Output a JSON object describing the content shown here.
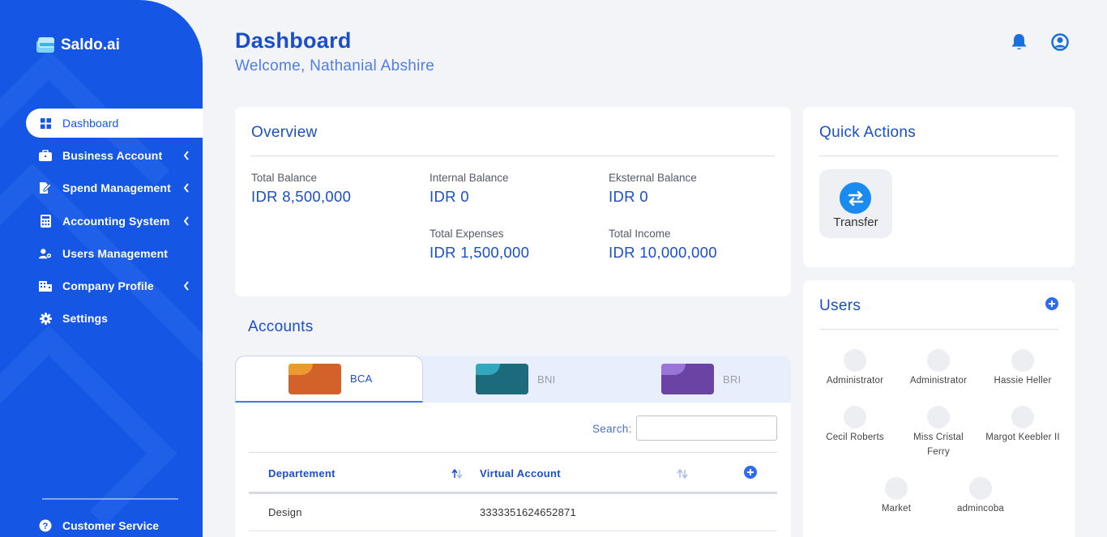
{
  "brand": {
    "name": "Saldo.ai"
  },
  "sidebar": {
    "items": [
      {
        "label": "Dashboard",
        "icon": "grid-icon",
        "active": true
      },
      {
        "label": "Business Account",
        "icon": "briefcase-icon"
      },
      {
        "label": "Spend Management",
        "icon": "file-edit-icon"
      },
      {
        "label": "Accounting System",
        "icon": "calculator-icon"
      },
      {
        "label": "Users Management",
        "icon": "users-cog-icon"
      },
      {
        "label": "Company Profile",
        "icon": "building-icon"
      },
      {
        "label": "Settings",
        "icon": "gear-icon"
      }
    ],
    "footer_label": "Customer Service"
  },
  "header": {
    "title": "Dashboard",
    "welcome": "Welcome, Nathanial Abshire"
  },
  "overview": {
    "title": "Overview",
    "total_balance_label": "Total Balance",
    "total_balance": "IDR 8,500,000",
    "internal_balance_label": "Internal Balance",
    "internal_balance": "IDR 0",
    "eksternal_balance_label": "Eksternal Balance",
    "eksternal_balance": "IDR 0",
    "total_expenses_label": "Total Expenses",
    "total_expenses": "IDR 1,500,000",
    "total_income_label": "Total Income",
    "total_income": "IDR 10,000,000"
  },
  "quick_actions": {
    "title": "Quick Actions",
    "transfer_label": "Transfer"
  },
  "users": {
    "title": "Users",
    "list": [
      "Administrator",
      "Administrator",
      "Hassie Heller",
      "Cecil Roberts",
      "Miss Cristal Ferry",
      "Margot Keebler II",
      "Market",
      "admincoba"
    ]
  },
  "accounts": {
    "title": "Accounts",
    "tabs": [
      {
        "label": "BCA",
        "color": "#d2622a"
      },
      {
        "label": "BNI",
        "color": "#1c6b7d"
      },
      {
        "label": "BRI",
        "color": "#6b43a4"
      }
    ],
    "search_label": "Search:",
    "columns": [
      "Departement",
      "Virtual Account"
    ],
    "rows": [
      {
        "department": "Design",
        "virtual_account": "3333351624652871"
      }
    ]
  },
  "colors": {
    "primary": "#1557e4",
    "accent": "#1a8bf0",
    "title": "#1a4fc9"
  }
}
